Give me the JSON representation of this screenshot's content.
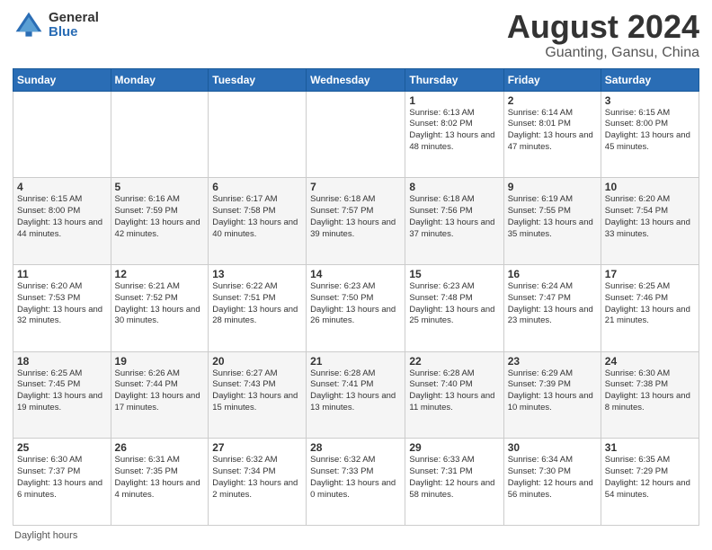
{
  "logo": {
    "general": "General",
    "blue": "Blue"
  },
  "title": {
    "month_year": "August 2024",
    "location": "Guanting, Gansu, China"
  },
  "days_of_week": [
    "Sunday",
    "Monday",
    "Tuesday",
    "Wednesday",
    "Thursday",
    "Friday",
    "Saturday"
  ],
  "weeks": [
    [
      {
        "day": "",
        "sunrise": "",
        "sunset": "",
        "daylight": ""
      },
      {
        "day": "",
        "sunrise": "",
        "sunset": "",
        "daylight": ""
      },
      {
        "day": "",
        "sunrise": "",
        "sunset": "",
        "daylight": ""
      },
      {
        "day": "",
        "sunrise": "",
        "sunset": "",
        "daylight": ""
      },
      {
        "day": "1",
        "sunrise": "Sunrise: 6:13 AM",
        "sunset": "Sunset: 8:02 PM",
        "daylight": "Daylight: 13 hours and 48 minutes."
      },
      {
        "day": "2",
        "sunrise": "Sunrise: 6:14 AM",
        "sunset": "Sunset: 8:01 PM",
        "daylight": "Daylight: 13 hours and 47 minutes."
      },
      {
        "day": "3",
        "sunrise": "Sunrise: 6:15 AM",
        "sunset": "Sunset: 8:00 PM",
        "daylight": "Daylight: 13 hours and 45 minutes."
      }
    ],
    [
      {
        "day": "4",
        "sunrise": "Sunrise: 6:15 AM",
        "sunset": "Sunset: 8:00 PM",
        "daylight": "Daylight: 13 hours and 44 minutes."
      },
      {
        "day": "5",
        "sunrise": "Sunrise: 6:16 AM",
        "sunset": "Sunset: 7:59 PM",
        "daylight": "Daylight: 13 hours and 42 minutes."
      },
      {
        "day": "6",
        "sunrise": "Sunrise: 6:17 AM",
        "sunset": "Sunset: 7:58 PM",
        "daylight": "Daylight: 13 hours and 40 minutes."
      },
      {
        "day": "7",
        "sunrise": "Sunrise: 6:18 AM",
        "sunset": "Sunset: 7:57 PM",
        "daylight": "Daylight: 13 hours and 39 minutes."
      },
      {
        "day": "8",
        "sunrise": "Sunrise: 6:18 AM",
        "sunset": "Sunset: 7:56 PM",
        "daylight": "Daylight: 13 hours and 37 minutes."
      },
      {
        "day": "9",
        "sunrise": "Sunrise: 6:19 AM",
        "sunset": "Sunset: 7:55 PM",
        "daylight": "Daylight: 13 hours and 35 minutes."
      },
      {
        "day": "10",
        "sunrise": "Sunrise: 6:20 AM",
        "sunset": "Sunset: 7:54 PM",
        "daylight": "Daylight: 13 hours and 33 minutes."
      }
    ],
    [
      {
        "day": "11",
        "sunrise": "Sunrise: 6:20 AM",
        "sunset": "Sunset: 7:53 PM",
        "daylight": "Daylight: 13 hours and 32 minutes."
      },
      {
        "day": "12",
        "sunrise": "Sunrise: 6:21 AM",
        "sunset": "Sunset: 7:52 PM",
        "daylight": "Daylight: 13 hours and 30 minutes."
      },
      {
        "day": "13",
        "sunrise": "Sunrise: 6:22 AM",
        "sunset": "Sunset: 7:51 PM",
        "daylight": "Daylight: 13 hours and 28 minutes."
      },
      {
        "day": "14",
        "sunrise": "Sunrise: 6:23 AM",
        "sunset": "Sunset: 7:50 PM",
        "daylight": "Daylight: 13 hours and 26 minutes."
      },
      {
        "day": "15",
        "sunrise": "Sunrise: 6:23 AM",
        "sunset": "Sunset: 7:48 PM",
        "daylight": "Daylight: 13 hours and 25 minutes."
      },
      {
        "day": "16",
        "sunrise": "Sunrise: 6:24 AM",
        "sunset": "Sunset: 7:47 PM",
        "daylight": "Daylight: 13 hours and 23 minutes."
      },
      {
        "day": "17",
        "sunrise": "Sunrise: 6:25 AM",
        "sunset": "Sunset: 7:46 PM",
        "daylight": "Daylight: 13 hours and 21 minutes."
      }
    ],
    [
      {
        "day": "18",
        "sunrise": "Sunrise: 6:25 AM",
        "sunset": "Sunset: 7:45 PM",
        "daylight": "Daylight: 13 hours and 19 minutes."
      },
      {
        "day": "19",
        "sunrise": "Sunrise: 6:26 AM",
        "sunset": "Sunset: 7:44 PM",
        "daylight": "Daylight: 13 hours and 17 minutes."
      },
      {
        "day": "20",
        "sunrise": "Sunrise: 6:27 AM",
        "sunset": "Sunset: 7:43 PM",
        "daylight": "Daylight: 13 hours and 15 minutes."
      },
      {
        "day": "21",
        "sunrise": "Sunrise: 6:28 AM",
        "sunset": "Sunset: 7:41 PM",
        "daylight": "Daylight: 13 hours and 13 minutes."
      },
      {
        "day": "22",
        "sunrise": "Sunrise: 6:28 AM",
        "sunset": "Sunset: 7:40 PM",
        "daylight": "Daylight: 13 hours and 11 minutes."
      },
      {
        "day": "23",
        "sunrise": "Sunrise: 6:29 AM",
        "sunset": "Sunset: 7:39 PM",
        "daylight": "Daylight: 13 hours and 10 minutes."
      },
      {
        "day": "24",
        "sunrise": "Sunrise: 6:30 AM",
        "sunset": "Sunset: 7:38 PM",
        "daylight": "Daylight: 13 hours and 8 minutes."
      }
    ],
    [
      {
        "day": "25",
        "sunrise": "Sunrise: 6:30 AM",
        "sunset": "Sunset: 7:37 PM",
        "daylight": "Daylight: 13 hours and 6 minutes."
      },
      {
        "day": "26",
        "sunrise": "Sunrise: 6:31 AM",
        "sunset": "Sunset: 7:35 PM",
        "daylight": "Daylight: 13 hours and 4 minutes."
      },
      {
        "day": "27",
        "sunrise": "Sunrise: 6:32 AM",
        "sunset": "Sunset: 7:34 PM",
        "daylight": "Daylight: 13 hours and 2 minutes."
      },
      {
        "day": "28",
        "sunrise": "Sunrise: 6:32 AM",
        "sunset": "Sunset: 7:33 PM",
        "daylight": "Daylight: 13 hours and 0 minutes."
      },
      {
        "day": "29",
        "sunrise": "Sunrise: 6:33 AM",
        "sunset": "Sunset: 7:31 PM",
        "daylight": "Daylight: 12 hours and 58 minutes."
      },
      {
        "day": "30",
        "sunrise": "Sunrise: 6:34 AM",
        "sunset": "Sunset: 7:30 PM",
        "daylight": "Daylight: 12 hours and 56 minutes."
      },
      {
        "day": "31",
        "sunrise": "Sunrise: 6:35 AM",
        "sunset": "Sunset: 7:29 PM",
        "daylight": "Daylight: 12 hours and 54 minutes."
      }
    ]
  ],
  "footer": {
    "daylight_hours_label": "Daylight hours"
  }
}
